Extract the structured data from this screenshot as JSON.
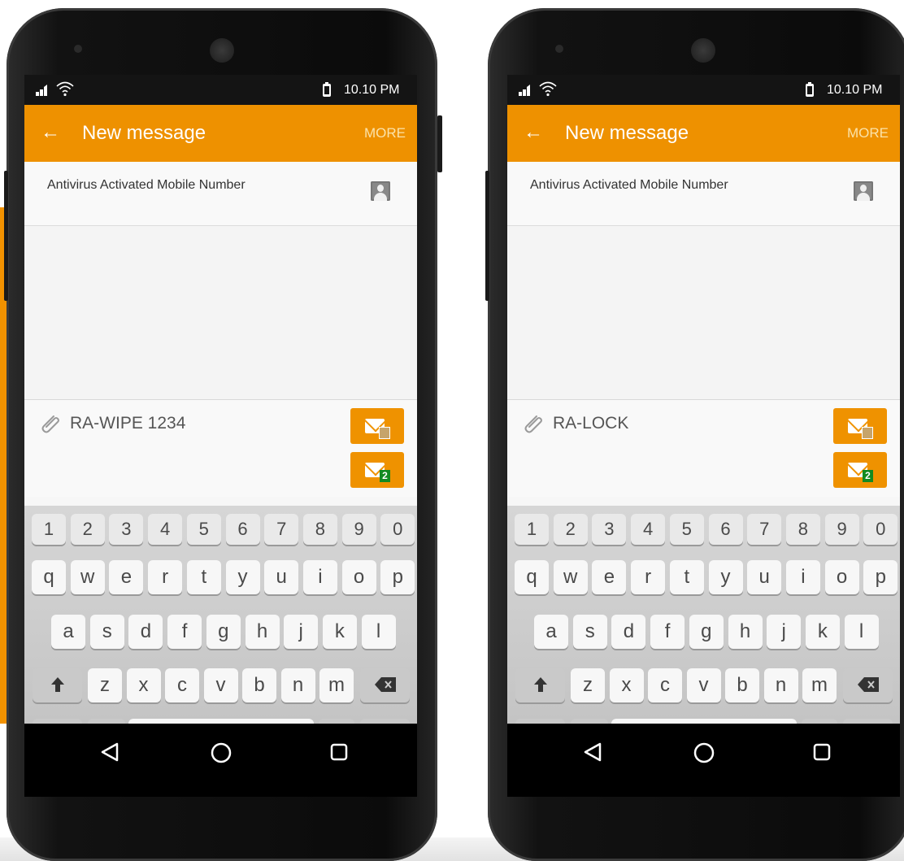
{
  "phones": [
    {
      "status_time": "10.10 PM",
      "app_title": "New message",
      "more_label": "MORE",
      "recipient_label": "Antivirus Activated Mobile Number",
      "message_text": "RA-WIPE 1234",
      "send_sim2_badge": "2"
    },
    {
      "status_time": "10.10 PM",
      "app_title": "New message",
      "more_label": "MORE",
      "recipient_label": "Antivirus Activated Mobile Number",
      "message_text": "RA-LOCK",
      "send_sim2_badge": "2"
    }
  ],
  "keyboard": {
    "numbers": [
      "1",
      "2",
      "3",
      "4",
      "5",
      "6",
      "7",
      "8",
      "9",
      "0"
    ],
    "row1": [
      "q",
      "w",
      "e",
      "r",
      "t",
      "y",
      "u",
      "i",
      "o",
      "p"
    ],
    "row2": [
      "a",
      "s",
      "d",
      "f",
      "g",
      "h",
      "j",
      "k",
      "l"
    ],
    "row3": [
      "z",
      "x",
      "c",
      "v",
      "b",
      "n",
      "m"
    ]
  },
  "icons": {
    "back": "arrow-left",
    "attach": "paperclip",
    "contact": "contact-card",
    "send_sim1": "envelope-sim1",
    "send_sim2": "envelope-sim2",
    "nav_back": "triangle-left",
    "nav_home": "circle",
    "nav_recent": "square"
  },
  "colors": {
    "accent": "#EE9100",
    "statusbar": "#141414"
  }
}
